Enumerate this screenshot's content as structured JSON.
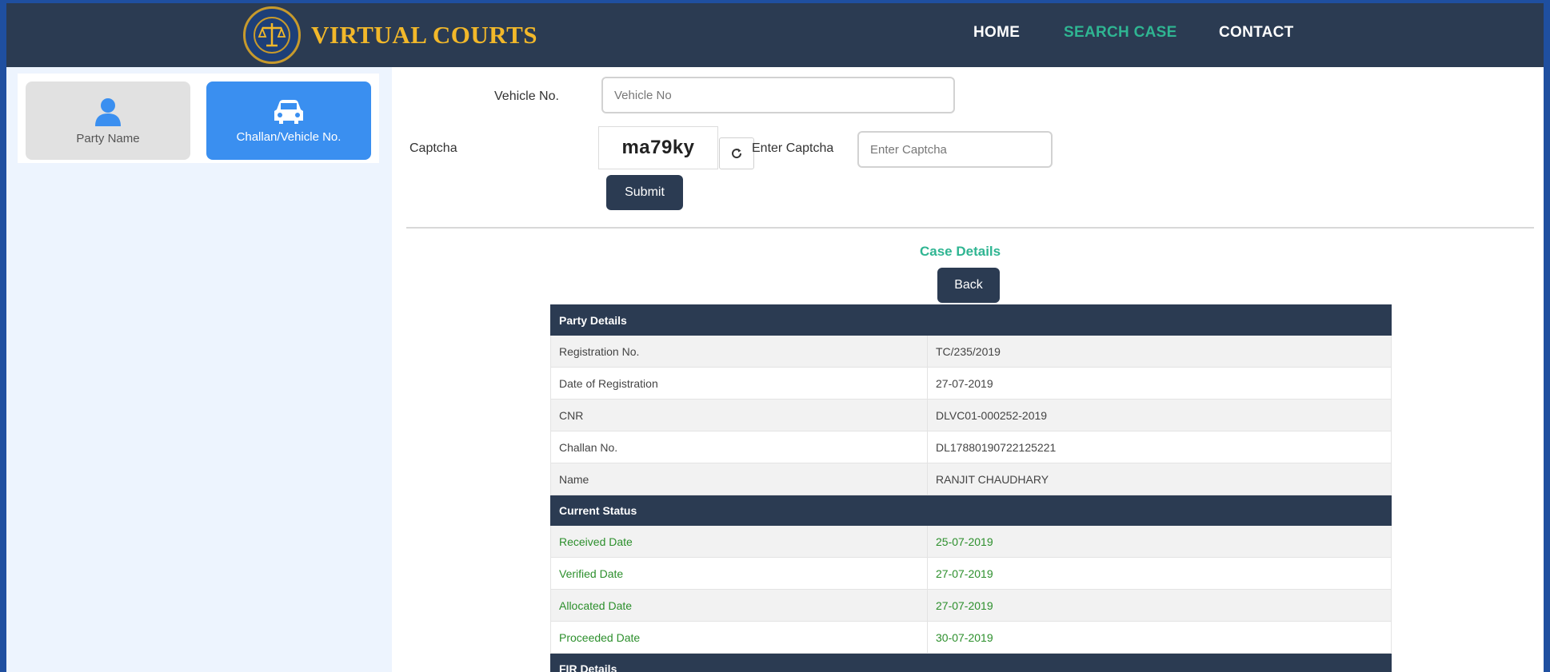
{
  "header": {
    "brand": "VIRTUAL COURTS",
    "nav": [
      {
        "label": "HOME",
        "active": false
      },
      {
        "label": "SEARCH CASE",
        "active": true
      },
      {
        "label": "CONTACT",
        "active": false
      }
    ]
  },
  "sidebar": {
    "tabs": [
      {
        "label": "Party Name",
        "icon": "user-icon",
        "selected": false
      },
      {
        "label": "Challan/Vehicle No.",
        "icon": "car-icon",
        "selected": true
      }
    ]
  },
  "form": {
    "vehicle_label": "Vehicle No.",
    "vehicle_placeholder": "Vehicle No",
    "captcha_label": "Captcha",
    "captcha_text": "ma79ky",
    "enter_captcha_label": "Enter Captcha",
    "enter_captcha_placeholder": "Enter Captcha",
    "submit_label": "Submit"
  },
  "case": {
    "title": "Case Details",
    "back_label": "Back",
    "party_section": "Party Details",
    "party_rows": [
      {
        "label": "Registration No.",
        "value": "TC/235/2019"
      },
      {
        "label": "Date of Registration",
        "value": "27-07-2019"
      },
      {
        "label": "CNR",
        "value": "DLVC01-000252-2019"
      },
      {
        "label": "Challan No.",
        "value": "DL17880190722125221"
      },
      {
        "label": "Name",
        "value": "RANJIT CHAUDHARY"
      }
    ],
    "status_section": "Current Status",
    "status_rows": [
      {
        "label": "Received Date",
        "value": "25-07-2019"
      },
      {
        "label": "Verified Date",
        "value": "27-07-2019"
      },
      {
        "label": "Allocated Date",
        "value": "27-07-2019"
      },
      {
        "label": "Proceeded Date",
        "value": "30-07-2019"
      }
    ],
    "fir_section": "FIR Details"
  },
  "colors": {
    "header_bg": "#2b3b52",
    "accent_green": "#2fb592",
    "brand_gold": "#f2b82a",
    "tab_selected": "#3a8ff0",
    "status_green": "#2c8f2c"
  }
}
